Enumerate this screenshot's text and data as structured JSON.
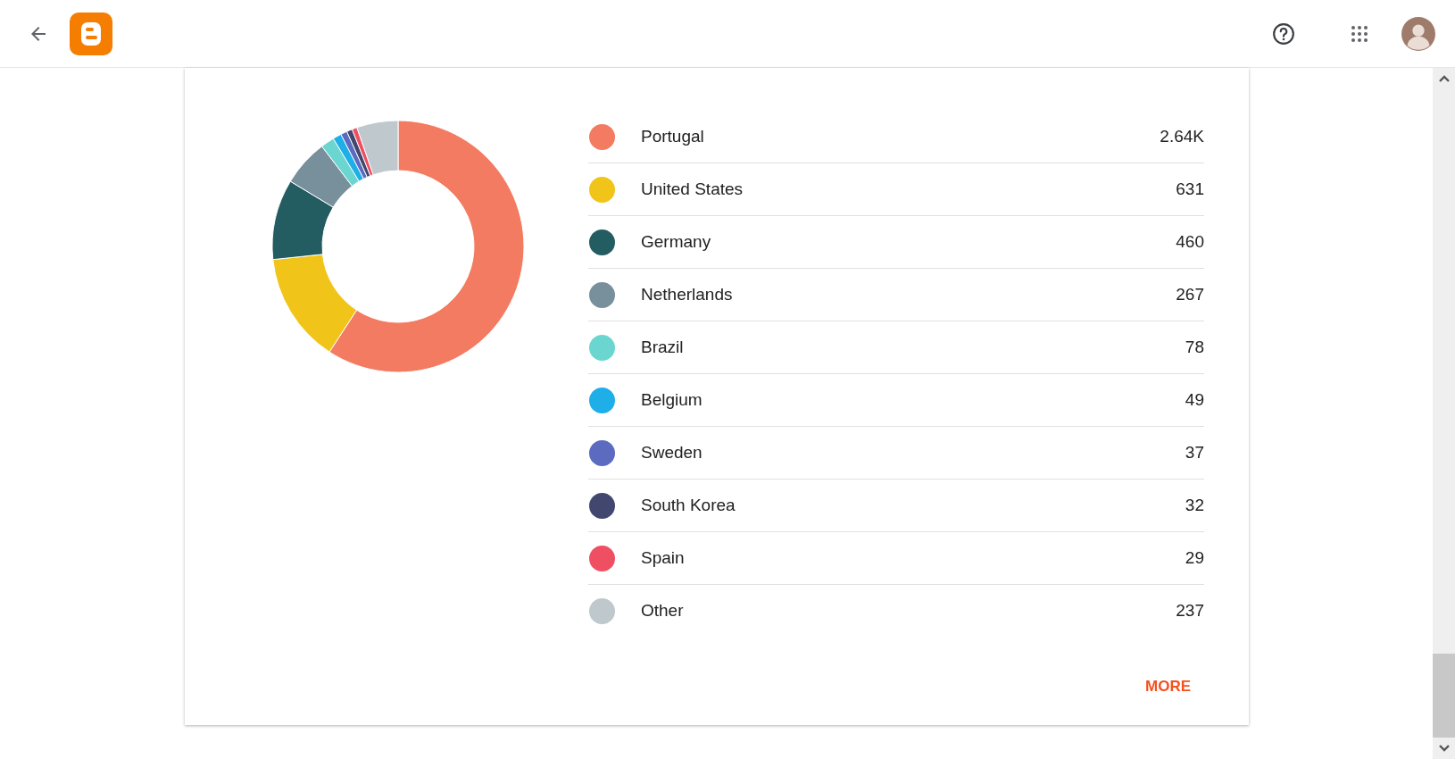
{
  "chart_data": {
    "type": "donut",
    "categories": [
      "Portugal",
      "United States",
      "Germany",
      "Netherlands",
      "Brazil",
      "Belgium",
      "Sweden",
      "South Korea",
      "Spain",
      "Other"
    ],
    "values": [
      59.19,
      14.15,
      10.31,
      5.99,
      1.75,
      1.1,
      0.83,
      0.72,
      0.65,
      5.31
    ]
  },
  "legend": [
    {
      "count": "2.64K",
      "color": "#f37b62"
    },
    {
      "count": "631",
      "color": "#f1c419"
    },
    {
      "count": "460",
      "color": "#235c61"
    },
    {
      "count": "267",
      "color": "#78909c"
    },
    {
      "count": "78",
      "color": "#6bd6d0"
    },
    {
      "count": "49",
      "color": "#1eaee8"
    },
    {
      "count": "37",
      "color": "#5c6bc0"
    },
    {
      "count": "32",
      "color": "#424770"
    },
    {
      "count": "29",
      "color": "#ef4f62"
    },
    {
      "count": "237",
      "color": "#bec8cd"
    }
  ],
  "more_button": "MORE"
}
